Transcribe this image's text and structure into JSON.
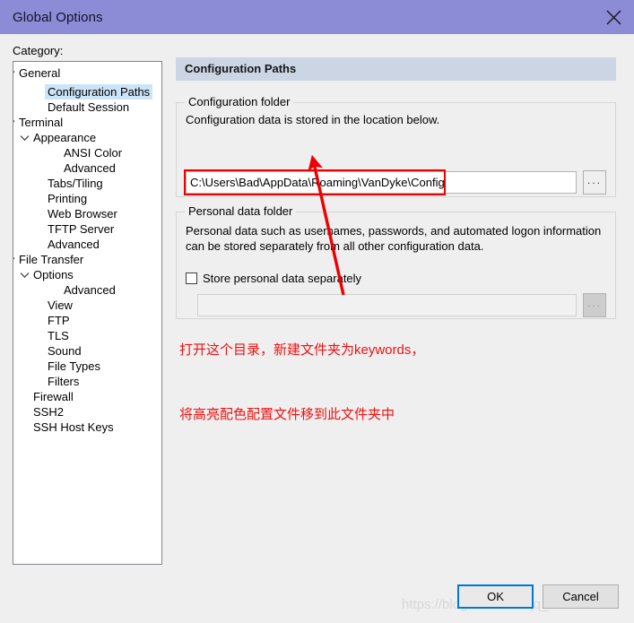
{
  "window": {
    "title": "Global Options",
    "close_icon": "close-icon"
  },
  "sidebar": {
    "label": "Category:",
    "items": [
      {
        "label": "General",
        "depth": 0,
        "expander": "chevron-down",
        "selected": false
      },
      {
        "label": "Configuration Paths",
        "depth": 2,
        "expander": "none",
        "selected": true
      },
      {
        "label": "Default Session",
        "depth": 2,
        "expander": "none",
        "selected": false
      },
      {
        "label": "Terminal",
        "depth": 0,
        "expander": "chevron-down",
        "selected": false
      },
      {
        "label": "Appearance",
        "depth": 1,
        "expander": "chevron-down",
        "selected": false
      },
      {
        "label": "ANSI Color",
        "depth": 3,
        "expander": "none",
        "selected": false
      },
      {
        "label": "Advanced",
        "depth": 3,
        "expander": "none",
        "selected": false
      },
      {
        "label": "Tabs/Tiling",
        "depth": 2,
        "expander": "none",
        "selected": false
      },
      {
        "label": "Printing",
        "depth": 2,
        "expander": "none",
        "selected": false
      },
      {
        "label": "Web Browser",
        "depth": 2,
        "expander": "none",
        "selected": false
      },
      {
        "label": "TFTP Server",
        "depth": 2,
        "expander": "none",
        "selected": false
      },
      {
        "label": "Advanced",
        "depth": 2,
        "expander": "none",
        "selected": false
      },
      {
        "label": "File Transfer",
        "depth": 0,
        "expander": "chevron-down",
        "selected": false
      },
      {
        "label": "Options",
        "depth": 1,
        "expander": "chevron-down",
        "selected": false
      },
      {
        "label": "Advanced",
        "depth": 3,
        "expander": "none",
        "selected": false
      },
      {
        "label": "View",
        "depth": 2,
        "expander": "none",
        "selected": false
      },
      {
        "label": "FTP",
        "depth": 2,
        "expander": "none",
        "selected": false
      },
      {
        "label": "TLS",
        "depth": 2,
        "expander": "none",
        "selected": false
      },
      {
        "label": "Sound",
        "depth": 2,
        "expander": "none",
        "selected": false
      },
      {
        "label": "File Types",
        "depth": 2,
        "expander": "none",
        "selected": false
      },
      {
        "label": "Filters",
        "depth": 2,
        "expander": "none",
        "selected": false
      },
      {
        "label": "Firewall",
        "depth": 1,
        "expander": "none",
        "selected": false
      },
      {
        "label": "SSH2",
        "depth": 1,
        "expander": "none",
        "selected": false
      },
      {
        "label": "SSH Host Keys",
        "depth": 1,
        "expander": "none",
        "selected": false
      }
    ]
  },
  "pane": {
    "header": "Configuration Paths",
    "config_group": {
      "legend": "Configuration folder",
      "description": "Configuration data is stored in the location below.",
      "path_value": "C:\\Users\\Bad\\AppData\\Roaming\\VanDyke\\Config",
      "browse_label": "...",
      "highlight_color": "#ee0000"
    },
    "personal_group": {
      "legend": "Personal data folder",
      "description_line1": "Personal data such as usernames, passwords, and automated logon information",
      "description_line2": "can be stored separately from all other configuration data.",
      "checkbox_label": "Store personal data separately",
      "checkbox_checked": false,
      "path_value": "",
      "browse_label": "..."
    }
  },
  "annotation": {
    "line1": "打开这个目录，新建文件夹为keywords，",
    "line2": "将高亮配色配置文件移到此文件夹中",
    "color": "#ee1111"
  },
  "footer": {
    "ok_label": "OK",
    "cancel_label": "Cancel"
  },
  "watermark": {
    "text": "https://blog.csdn.net/qq_45668124"
  }
}
